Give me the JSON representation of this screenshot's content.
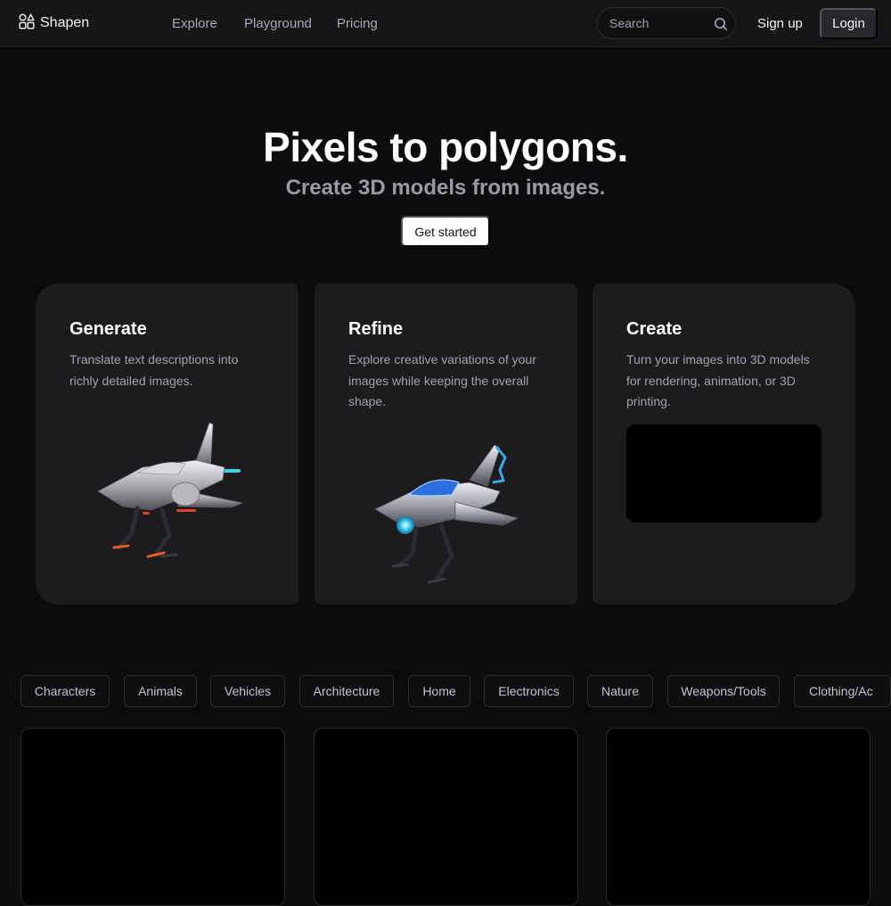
{
  "nav": {
    "brand": "Shapen",
    "brand_icon": "shapes-logo-icon",
    "links": [
      "Explore",
      "Playground",
      "Pricing"
    ],
    "search_placeholder": "Search",
    "signup": "Sign up",
    "login": "Login"
  },
  "hero": {
    "title": "Pixels to polygons.",
    "subtitle": "Create 3D models from images.",
    "cta": "Get started"
  },
  "features": [
    {
      "title": "Generate",
      "description": "Translate text descriptions into richly detailed images."
    },
    {
      "title": "Refine",
      "description": "Explore creative variations of your images while keeping the overall shape."
    },
    {
      "title": "Create",
      "description": "Turn your images into 3D models for rendering, animation, or 3D printing."
    }
  ],
  "categories": [
    "Characters",
    "Animals",
    "Vehicles",
    "Architecture",
    "Home",
    "Electronics",
    "Nature",
    "Weapons/Tools",
    "Clothing/Ac"
  ],
  "colors": {
    "background": "#0c0c0e",
    "card": "#1c1c1f",
    "accent_cyan": "#3fd0f0",
    "accent_blue": "#2a6ee0"
  }
}
